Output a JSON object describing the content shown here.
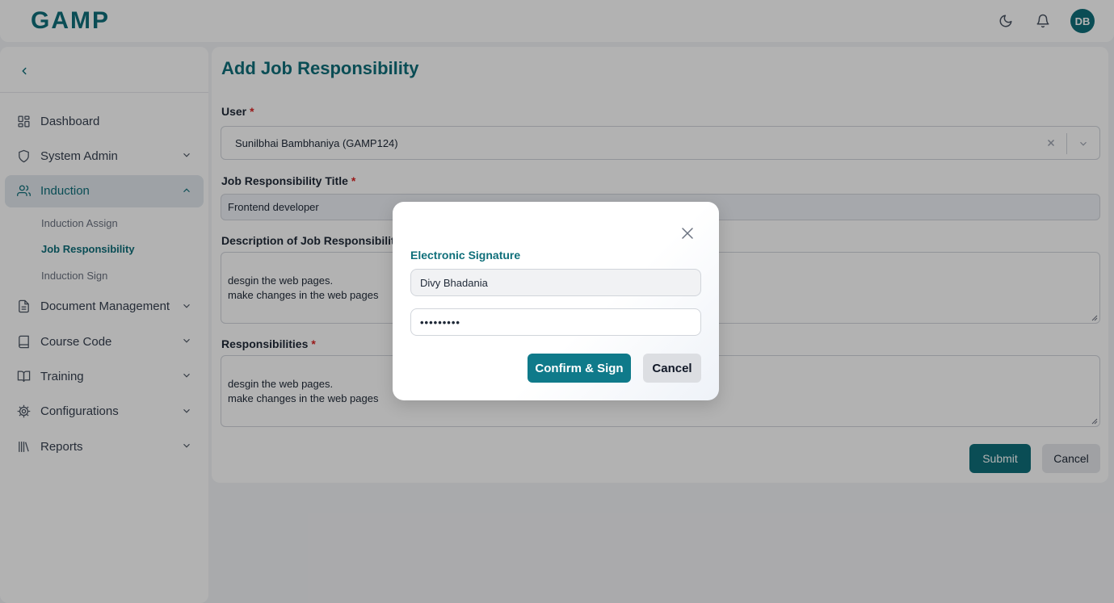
{
  "header": {
    "logo_text": "GAMP",
    "avatar_initials": "DB",
    "icons": [
      "moon-icon",
      "bell-icon"
    ]
  },
  "sidebar": {
    "items": [
      {
        "label": "Dashboard",
        "icon": "dashboard-icon"
      },
      {
        "label": "System Admin",
        "icon": "shield-icon"
      },
      {
        "label": "Induction",
        "icon": "users-icon",
        "active": true
      },
      {
        "label": "Document Management",
        "icon": "document-icon"
      },
      {
        "label": "Course Code",
        "icon": "book-icon"
      },
      {
        "label": "Training",
        "icon": "open-book-icon"
      },
      {
        "label": "Configurations",
        "icon": "gear-icon"
      },
      {
        "label": "Reports",
        "icon": "library-icon"
      }
    ],
    "induction_sub": [
      {
        "label": "Induction Assign"
      },
      {
        "label": "Job Responsibility",
        "active": true
      },
      {
        "label": "Induction Sign"
      }
    ]
  },
  "form": {
    "title": "Add Job Responsibility",
    "user_label": "User",
    "user_value": "Sunilbhai Bambhaniya (GAMP124)",
    "title_label": "Job Responsibility Title",
    "title_value": "Frontend developer",
    "description_label": "Description of Job Responsibility",
    "description_value": "desgin the web pages.\nmake changes in the web pages",
    "responsibilities_label": "Responsibilities",
    "responsibilities_value": "desgin the web pages.\nmake changes in the web pages",
    "required_mark": "*",
    "submit_label": "Submit",
    "cancel_label": "Cancel"
  },
  "modal": {
    "title": "Electronic Signature",
    "name_value": "Divy Bhadania",
    "password_value": "•••••••••",
    "confirm_label": "Confirm & Sign",
    "cancel_label": "Cancel"
  },
  "colors": {
    "primary": "#0f6f7a",
    "required": "#dc2626",
    "overlay": "rgba(0,0,0,0.3)"
  }
}
